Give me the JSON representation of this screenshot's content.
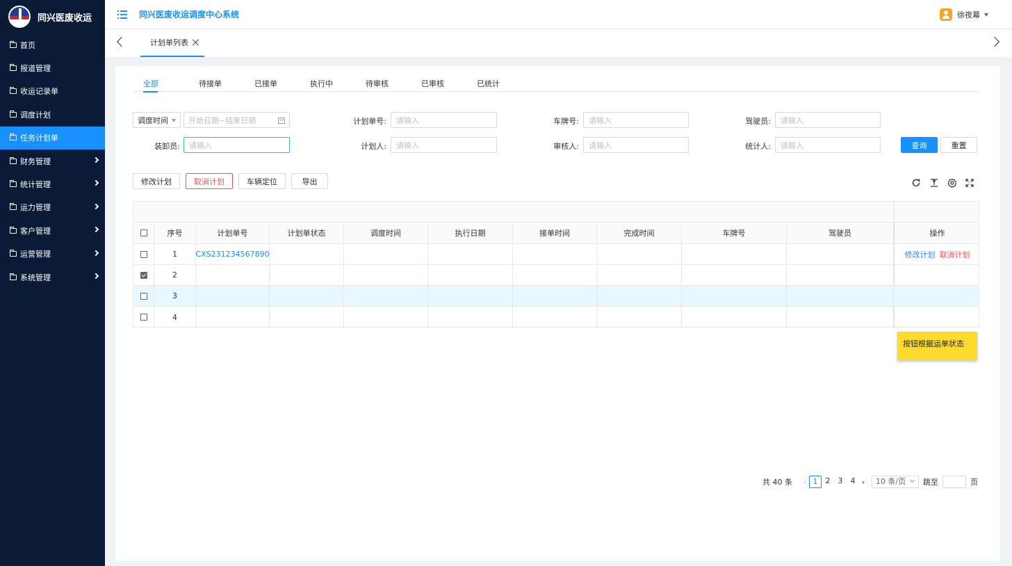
{
  "sidebar": {
    "logo_text": "同兴医废收运",
    "items": [
      {
        "label": "首页",
        "has_children": false,
        "active": false
      },
      {
        "label": "报道管理",
        "has_children": false,
        "active": false
      },
      {
        "label": "收运记录单",
        "has_children": false,
        "active": false
      },
      {
        "label": "调度计划",
        "has_children": false,
        "active": false
      },
      {
        "label": "任务计划单",
        "has_children": false,
        "active": true
      },
      {
        "label": "财务管理",
        "has_children": true,
        "active": false
      },
      {
        "label": "统计管理",
        "has_children": true,
        "active": false
      },
      {
        "label": "运力管理",
        "has_children": true,
        "active": false
      },
      {
        "label": "客户管理",
        "has_children": true,
        "active": false
      },
      {
        "label": "运营管理",
        "has_children": true,
        "active": false
      },
      {
        "label": "系统管理",
        "has_children": true,
        "active": false
      }
    ]
  },
  "header": {
    "title": "同兴医废收运调度中心系统",
    "user_name": "徐夜幕"
  },
  "tabbar": {
    "active_tab": "计划单列表"
  },
  "status_tabs": [
    "全部",
    "待接单",
    "已接单",
    "执行中",
    "待审核",
    "已审核",
    "已统计"
  ],
  "filters": {
    "time_type": "调度时间",
    "date_placeholder": "开始日期~结束日期",
    "plan_no_label": "计划单号:",
    "plate_label": "车牌号:",
    "driver_label": "驾驶员:",
    "loader_label": "装卸员:",
    "planner_label": "计划人:",
    "auditor_label": "审核人:",
    "stat_label": "统计人:",
    "placeholder": "请输入",
    "query_button": "查询",
    "reset_button": "重置"
  },
  "actions": {
    "edit": "修改计划",
    "cancel": "取消计划",
    "locate": "车辆定位",
    "export": "导出"
  },
  "table": {
    "columns": [
      "序号",
      "计划单号",
      "计划单状态",
      "调度时间",
      "执行日期",
      "接单时间",
      "完成时间",
      "车牌号",
      "驾驶员",
      "操作"
    ],
    "rows": [
      {
        "index": "1",
        "plan_no": "CXS231234567890",
        "checked": false,
        "highlight": false,
        "ops": true
      },
      {
        "index": "2",
        "plan_no": "",
        "checked": true,
        "highlight": false,
        "ops": false
      },
      {
        "index": "3",
        "plan_no": "",
        "checked": false,
        "highlight": true,
        "ops": false
      },
      {
        "index": "4",
        "plan_no": "",
        "checked": false,
        "highlight": false,
        "ops": false
      }
    ],
    "op_edit": "修改计划",
    "op_cancel": "取消计划"
  },
  "note": "按钮根据运单状态",
  "pagination": {
    "total": "共 40 条",
    "pages": [
      "1",
      "2",
      "3",
      "4"
    ],
    "current": "1",
    "page_size": "10 条/页",
    "jump_label": "跳至",
    "page_unit": "页"
  },
  "colors": {
    "primary": "#1890ff",
    "danger": "#ff4d4f",
    "sidebar_bg": "#0b1a36",
    "note_bg": "#fcdb2c"
  }
}
